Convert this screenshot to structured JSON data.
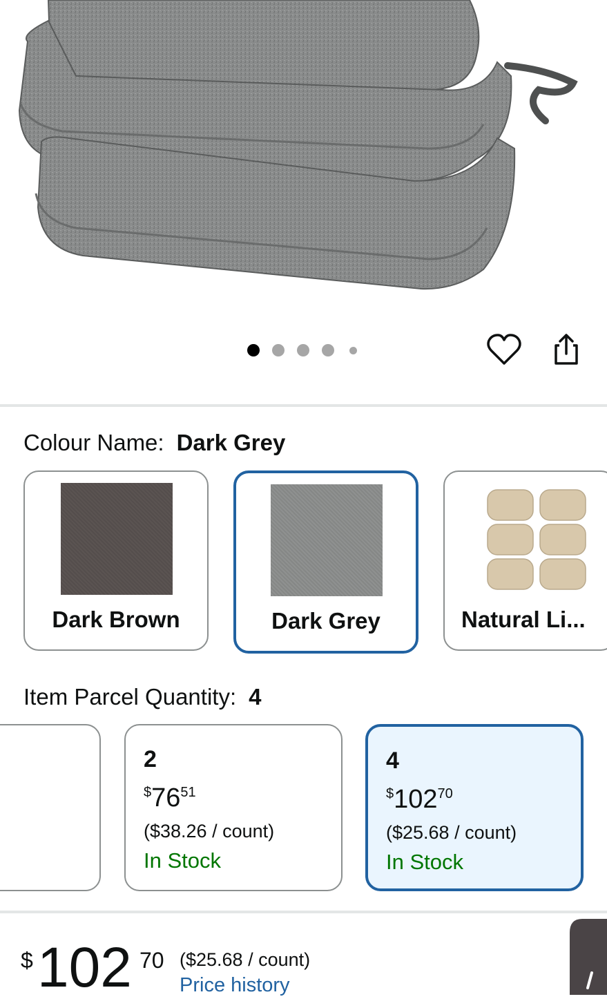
{
  "colors": {
    "accent_border": "#2162a1",
    "selected_bg": "#eaf5fe",
    "in_stock": "#007600",
    "link": "#2162a1"
  },
  "carousel": {
    "dot_count": 5,
    "active_index": 0
  },
  "actions": {
    "favorite_icon": "heart-icon",
    "share_icon": "share-icon"
  },
  "colour": {
    "label": "Colour Name:",
    "selected": "Dark Grey",
    "options": [
      {
        "name": "Dark Brown",
        "swatch_color": "#5b5452"
      },
      {
        "name": "Dark Grey",
        "swatch_color": "#8f9190"
      },
      {
        "name": "Natural Li...",
        "swatch_color": "#d8c8ab"
      }
    ]
  },
  "quantity": {
    "label": "Item Parcel Quantity:",
    "selected": "4",
    "options": [
      {
        "count": "2",
        "price_symbol": "$",
        "price_whole": "76",
        "price_fraction": "51",
        "unit_price": "($38.26 / count)",
        "stock": "In Stock"
      },
      {
        "count": "4",
        "price_symbol": "$",
        "price_whole": "102",
        "price_fraction": "70",
        "unit_price": "($25.68 / count)",
        "stock": "In Stock"
      }
    ]
  },
  "price": {
    "symbol": "$",
    "whole": "102",
    "fraction": "70",
    "unit_price": "($25.68 / count)",
    "history_link": "Price history"
  }
}
